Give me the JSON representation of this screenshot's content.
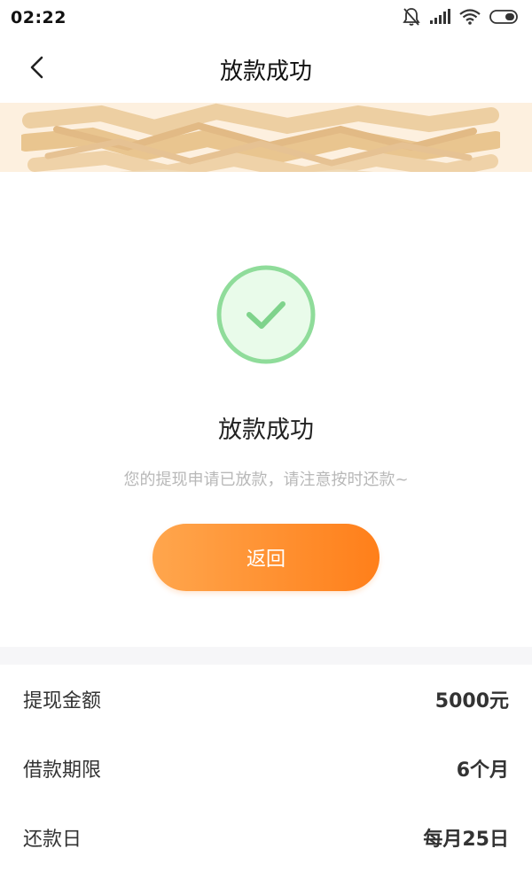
{
  "status_bar": {
    "time": "02:22"
  },
  "nav": {
    "title": "放款成功",
    "back_icon": "chevron-left-icon"
  },
  "result": {
    "title": "放款成功",
    "description": "您的提现申请已放款，请注意按时还款~",
    "icon": "check-circle-icon",
    "button_label": "返回"
  },
  "details": {
    "rows": [
      {
        "label": "提现金额",
        "value": "5000元"
      },
      {
        "label": "借款期限",
        "value": "6个月"
      },
      {
        "label": "还款日",
        "value": "每月25日"
      }
    ]
  },
  "colors": {
    "accent_start": "#ffa64d",
    "accent_end": "#ff7f1a",
    "success_green": "#8fdc9a",
    "success_fill": "#e9fbea",
    "banner_bg": "#fdf0df"
  }
}
